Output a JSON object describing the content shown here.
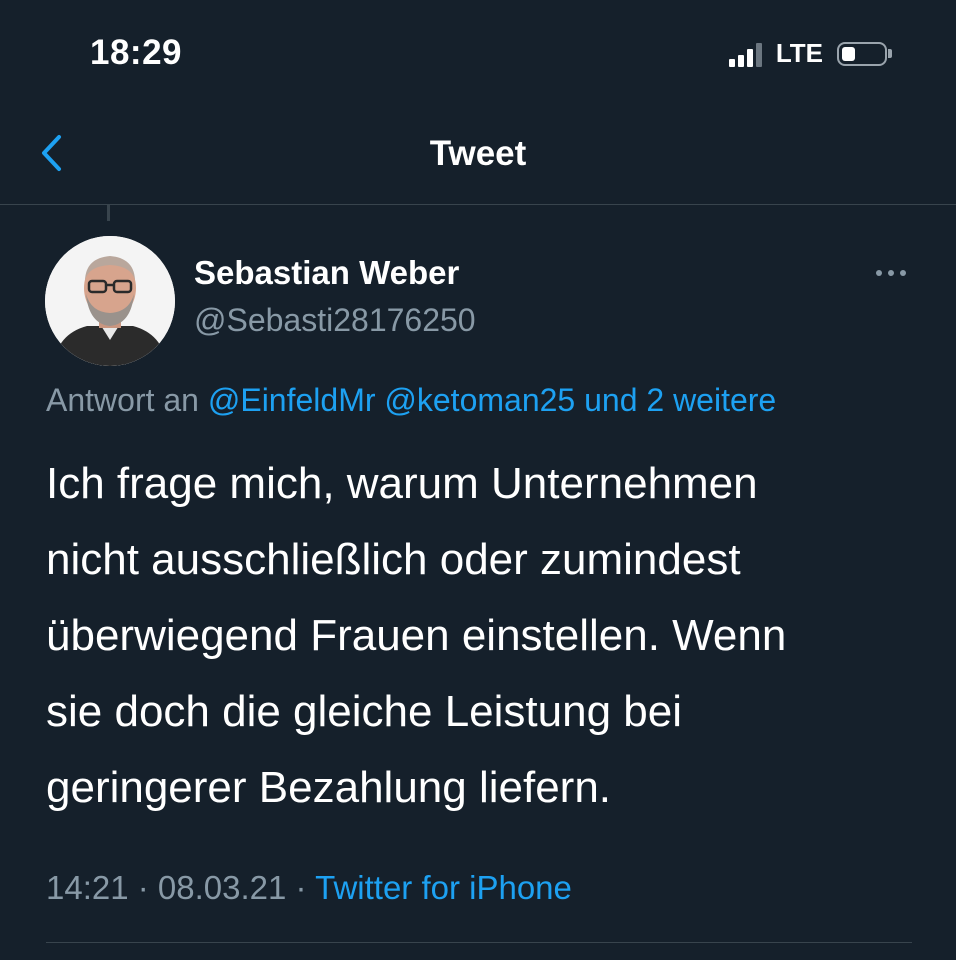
{
  "status_bar": {
    "time": "18:29",
    "network": "LTE"
  },
  "nav": {
    "title": "Tweet",
    "back_icon": "chevron-left-icon"
  },
  "tweet": {
    "author": {
      "name": "Sebastian Weber",
      "handle": "@Sebasti28176250"
    },
    "reply": {
      "prefix": "Antwort an",
      "mentions": "@EinfeldMr @ketoman25 und 2 weitere"
    },
    "text": "Ich frage mich, warum Unternehmen\nnicht ausschließlich oder zumindest\nüberwiegend Frauen einstellen. Wenn\nsie doch die gleiche Leistung bei\ngeringerer Bezahlung liefern.",
    "timestamp": "14:21 · 08.03.21 ·",
    "source": "Twitter for iPhone"
  },
  "colors": {
    "background": "#15202b",
    "accent": "#1da1f2",
    "secondary_text": "#8899a6",
    "divider": "#38444d"
  }
}
